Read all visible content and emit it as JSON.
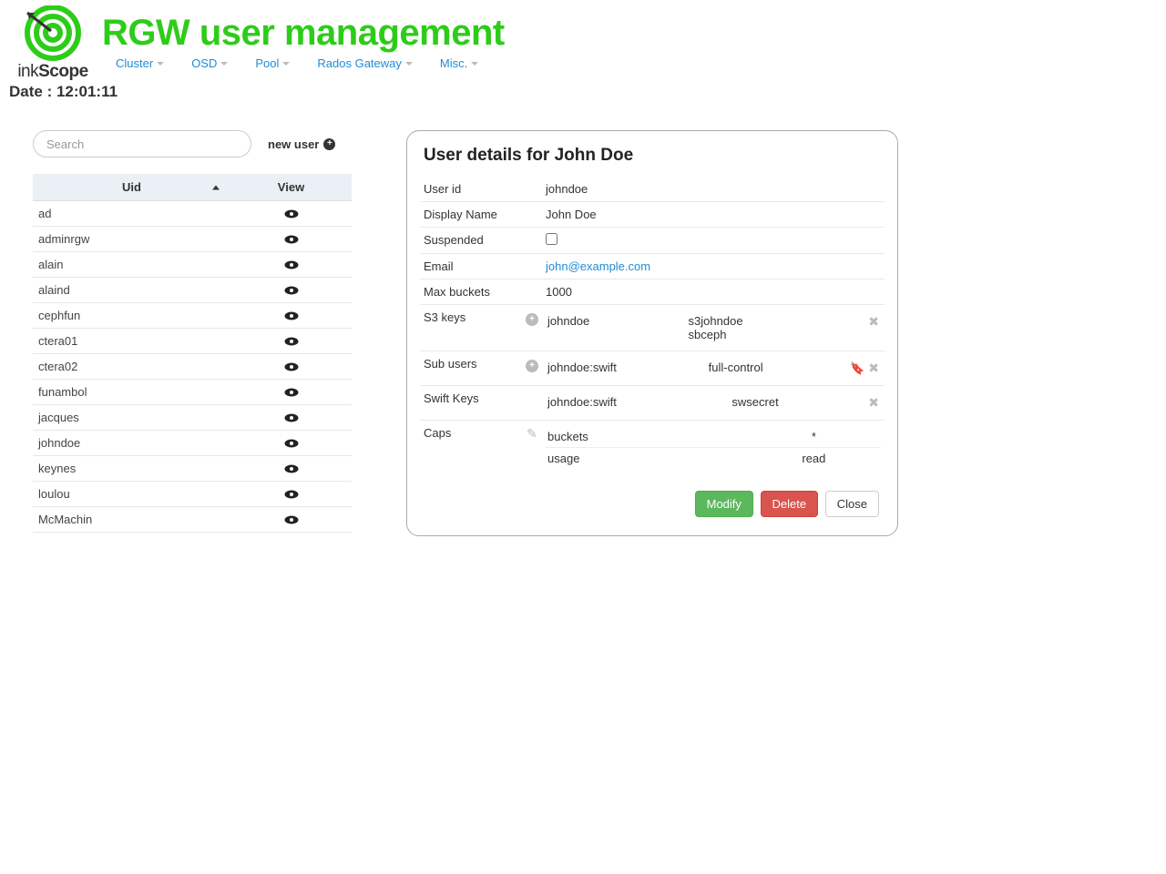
{
  "brand": {
    "name_prefix": "ink",
    "name_bold": "Scope"
  },
  "page_title": "RGW user management",
  "nav": [
    {
      "label": "Cluster"
    },
    {
      "label": "OSD"
    },
    {
      "label": "Pool"
    },
    {
      "label": "Rados Gateway"
    },
    {
      "label": "Misc."
    }
  ],
  "date_label": "Date : 12:01:11",
  "search": {
    "placeholder": "Search",
    "value": ""
  },
  "new_user_label": "new user",
  "table": {
    "col_uid": "Uid",
    "col_view": "View",
    "rows": [
      "ad",
      "adminrgw",
      "alain",
      "alaind",
      "cephfun",
      "ctera01",
      "ctera02",
      "funambol",
      "jacques",
      "johndoe",
      "keynes",
      "loulou",
      "McMachin"
    ]
  },
  "details": {
    "heading": "User details for John Doe",
    "labels": {
      "user_id": "User id",
      "display_name": "Display Name",
      "suspended": "Suspended",
      "email": "Email",
      "max_buckets": "Max buckets",
      "s3keys": "S3 keys",
      "subusers": "Sub users",
      "swiftkeys": "Swift Keys",
      "caps": "Caps"
    },
    "user_id": "johndoe",
    "display_name": "John Doe",
    "suspended": false,
    "email": "john@example.com",
    "max_buckets": "1000",
    "s3keys": [
      {
        "user": "johndoe",
        "access": "s3johndoe",
        "secret": "sbceph"
      }
    ],
    "subusers": [
      {
        "id": "johndoe:swift",
        "perm": "full-control"
      }
    ],
    "swiftkeys": [
      {
        "user": "johndoe:swift",
        "secret": "swsecret"
      }
    ],
    "caps": [
      {
        "type": "buckets",
        "perm": "*"
      },
      {
        "type": "usage",
        "perm": "read"
      }
    ]
  },
  "buttons": {
    "modify": "Modify",
    "delete": "Delete",
    "close": "Close"
  }
}
